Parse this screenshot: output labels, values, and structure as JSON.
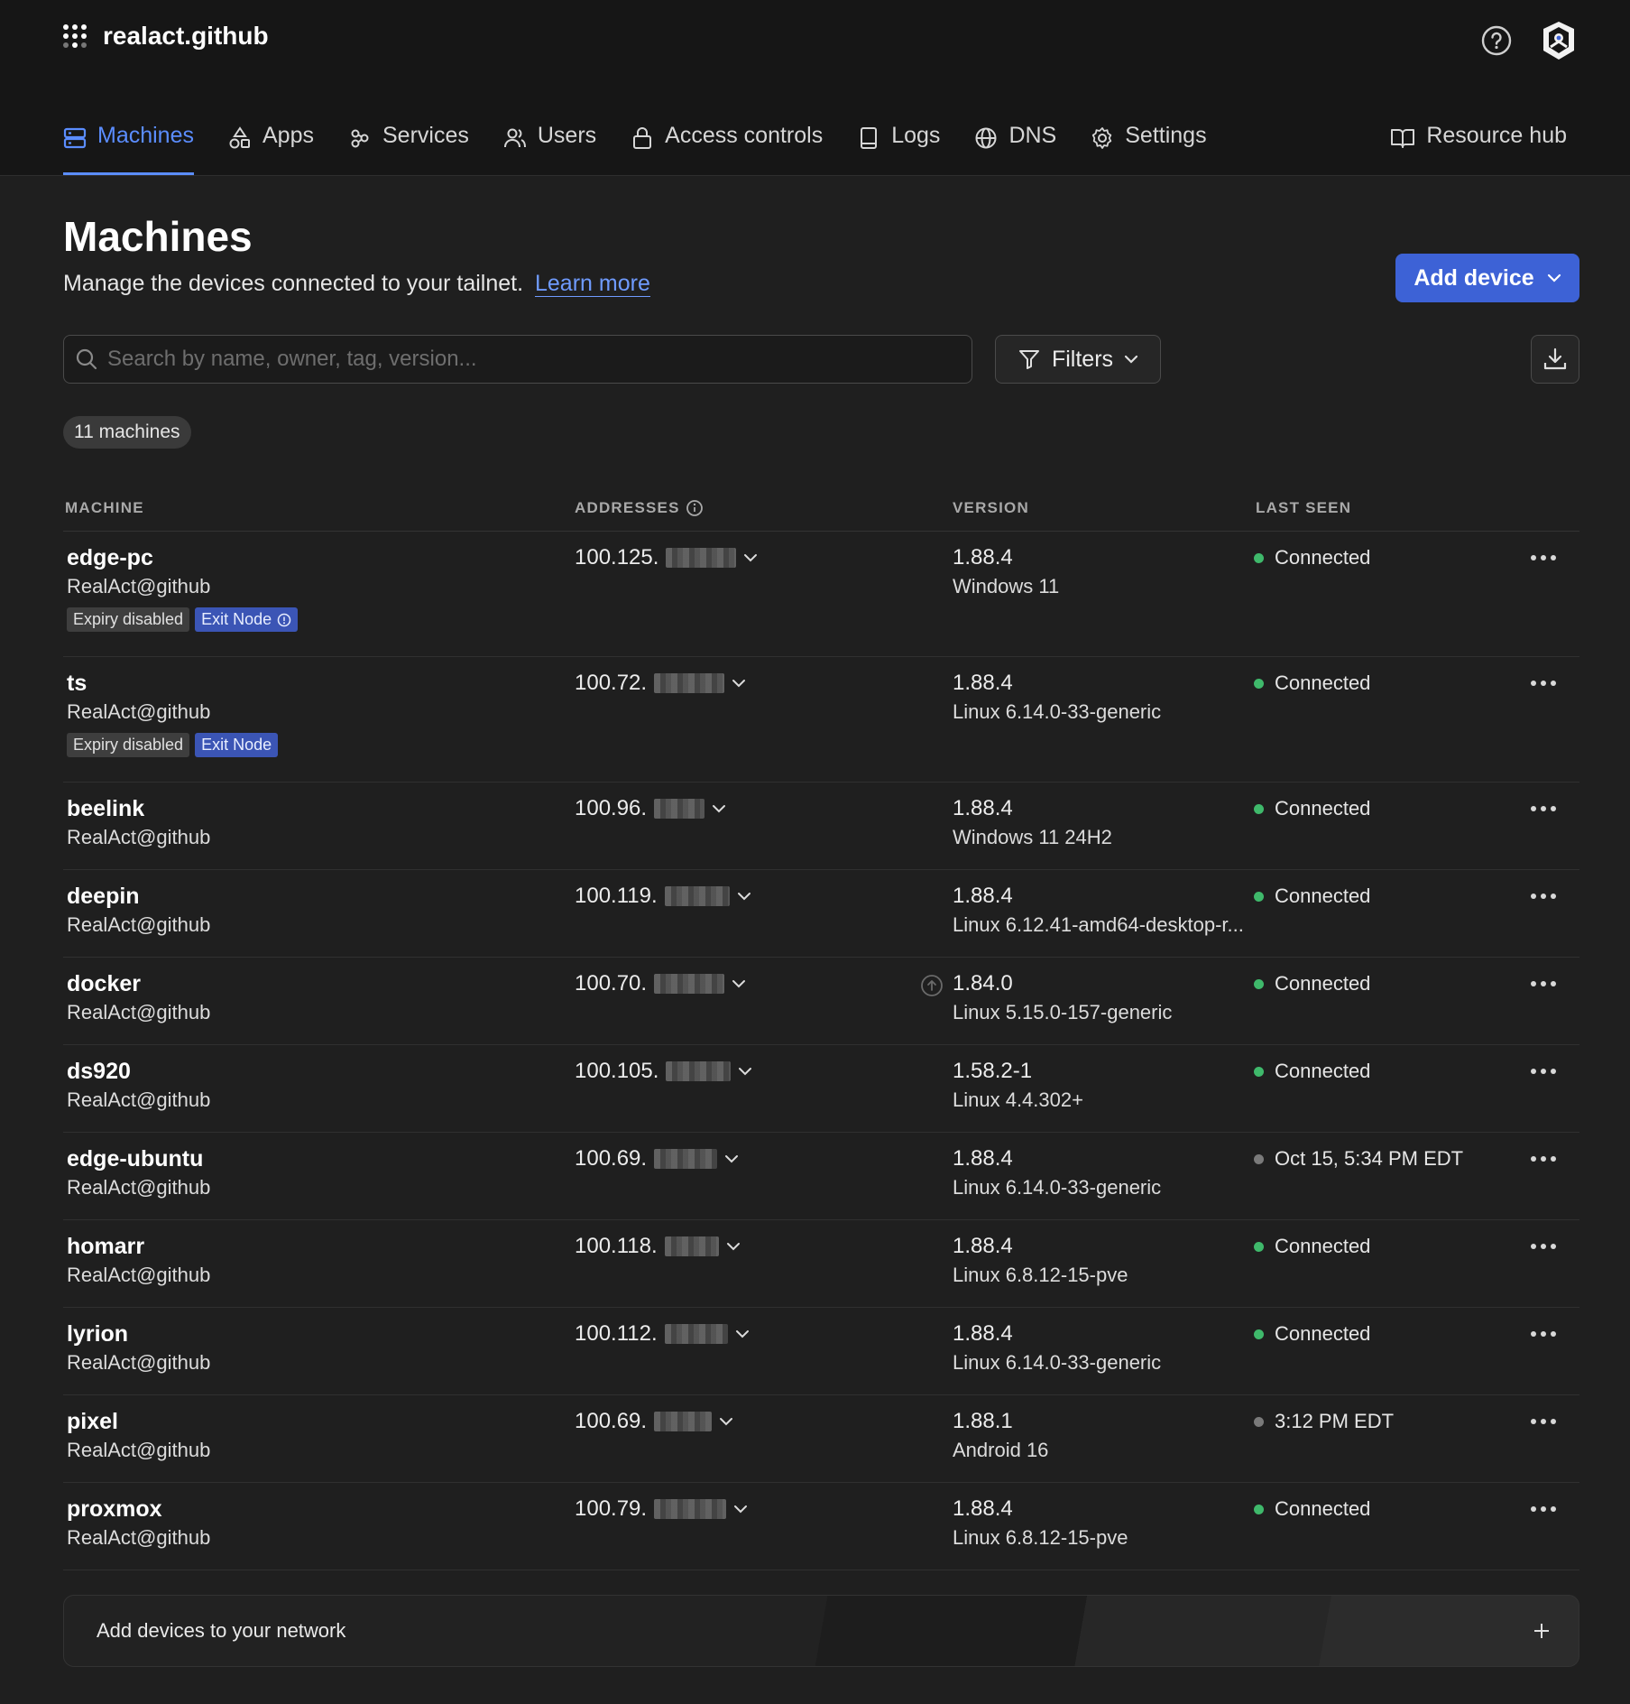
{
  "brand": {
    "name": "realact.github"
  },
  "nav": [
    {
      "key": "machines",
      "label": "Machines",
      "active": true
    },
    {
      "key": "apps",
      "label": "Apps"
    },
    {
      "key": "services",
      "label": "Services"
    },
    {
      "key": "users",
      "label": "Users"
    },
    {
      "key": "access",
      "label": "Access controls"
    },
    {
      "key": "logs",
      "label": "Logs"
    },
    {
      "key": "dns",
      "label": "DNS"
    },
    {
      "key": "settings",
      "label": "Settings"
    }
  ],
  "nav_right": {
    "label": "Resource hub"
  },
  "page": {
    "title": "Machines",
    "subtitle": "Manage the devices connected to your tailnet.",
    "learn_more": "Learn more",
    "add_device": "Add device"
  },
  "search": {
    "placeholder": "Search by name, owner, tag, version..."
  },
  "filters": {
    "label": "Filters"
  },
  "count": {
    "label": "11 machines"
  },
  "table": {
    "headers": {
      "machine": "MACHINE",
      "addresses": "ADDRESSES",
      "version": "VERSION",
      "last_seen": "LAST SEEN"
    },
    "rows": [
      {
        "name": "edge-pc",
        "owner": "RealAct@github",
        "addr": "100.125.",
        "version": "1.88.4",
        "os": "Windows 11",
        "seen": "Connected",
        "tags": [
          "Expiry disabled",
          "Exit Node"
        ]
      },
      {
        "name": "ts",
        "owner": "RealAct@github",
        "addr": "100.72.",
        "version": "1.88.4",
        "os": "Linux 6.14.0-33-generic",
        "seen": "Connected",
        "tags": [
          "Expiry disabled",
          "Exit Node"
        ]
      },
      {
        "name": "beelink",
        "owner": "RealAct@github",
        "addr": "100.96.",
        "version": "1.88.4",
        "os": "Windows 11 24H2",
        "seen": "Connected"
      },
      {
        "name": "deepin",
        "owner": "RealAct@github",
        "addr": "100.119.",
        "version": "1.88.4",
        "os": "Linux 6.12.41-amd64-desktop-r...",
        "seen": "Connected"
      },
      {
        "name": "docker",
        "owner": "RealAct@github",
        "addr": "100.70.",
        "version": "1.84.0",
        "os": "Linux 5.15.0-157-generic",
        "seen": "Connected"
      },
      {
        "name": "ds920",
        "owner": "RealAct@github",
        "addr": "100.105.",
        "version": "1.58.2-1",
        "os": "Linux 4.4.302+",
        "seen": "Connected"
      },
      {
        "name": "edge-ubuntu",
        "owner": "RealAct@github",
        "addr": "100.69.",
        "version": "1.88.4",
        "os": "Linux 6.14.0-33-generic",
        "seen": "Oct 15, 5:34 PM EDT"
      },
      {
        "name": "homarr",
        "owner": "RealAct@github",
        "addr": "100.118.",
        "version": "1.88.4",
        "os": "Linux 6.8.12-15-pve",
        "seen": "Connected"
      },
      {
        "name": "lyrion",
        "owner": "RealAct@github",
        "addr": "100.112.",
        "version": "1.88.4",
        "os": "Linux 6.14.0-33-generic",
        "seen": "Connected"
      },
      {
        "name": "pixel",
        "owner": "RealAct@github",
        "addr": "100.69.",
        "version": "1.88.1",
        "os": "Android 16",
        "seen": "3:12 PM EDT"
      },
      {
        "name": "proxmox",
        "owner": "RealAct@github",
        "addr": "100.79.",
        "version": "1.88.4",
        "os": "Linux 6.8.12-15-pve",
        "seen": "Connected"
      }
    ]
  },
  "banner": {
    "label": "Add devices to your network"
  },
  "colors": {
    "accent": "#5b8dff",
    "primary_button": "#3d62d6",
    "online": "#3fb96b",
    "offline": "#7a7a7a",
    "background": "#1f1f1f"
  }
}
